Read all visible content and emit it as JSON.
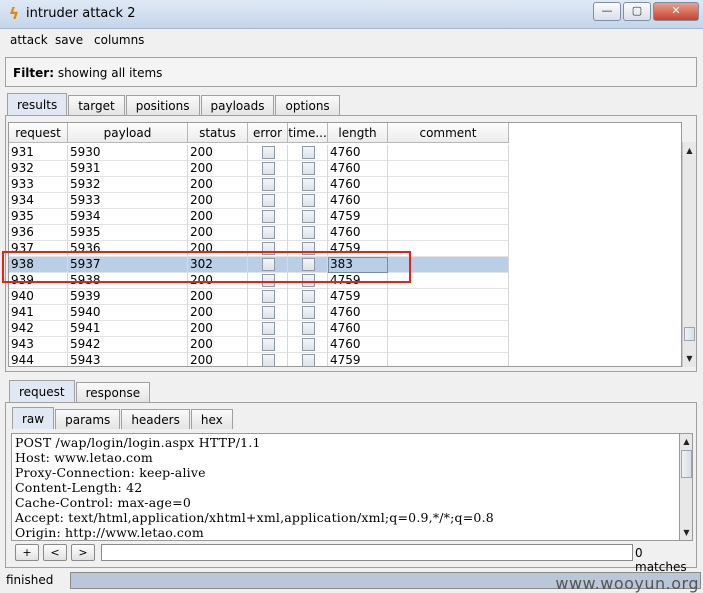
{
  "window": {
    "title": "intruder attack 2",
    "minimize": "—",
    "maximize": "▢",
    "close": "✕",
    "icon": "burp-lightning-icon"
  },
  "menu": [
    "attack",
    "save",
    "columns"
  ],
  "filter": {
    "label": "Filter:",
    "text": "showing all items"
  },
  "main_tabs": [
    {
      "label": "results",
      "active": true
    },
    {
      "label": "target",
      "active": false
    },
    {
      "label": "positions",
      "active": false
    },
    {
      "label": "payloads",
      "active": false
    },
    {
      "label": "options",
      "active": false
    }
  ],
  "table": {
    "columns": [
      "request",
      "payload",
      "status",
      "error",
      "time...",
      "length",
      "comment"
    ],
    "rows": [
      {
        "request": "931",
        "payload": "5930",
        "status": "200",
        "length": "4760"
      },
      {
        "request": "932",
        "payload": "5931",
        "status": "200",
        "length": "4760"
      },
      {
        "request": "933",
        "payload": "5932",
        "status": "200",
        "length": "4760"
      },
      {
        "request": "934",
        "payload": "5933",
        "status": "200",
        "length": "4760"
      },
      {
        "request": "935",
        "payload": "5934",
        "status": "200",
        "length": "4759"
      },
      {
        "request": "936",
        "payload": "5935",
        "status": "200",
        "length": "4760"
      },
      {
        "request": "937",
        "payload": "5936",
        "status": "200",
        "length": "4759"
      },
      {
        "request": "938",
        "payload": "5937",
        "status": "302",
        "length": "383",
        "selected": true
      },
      {
        "request": "939",
        "payload": "5938",
        "status": "200",
        "length": "4759"
      },
      {
        "request": "940",
        "payload": "5939",
        "status": "200",
        "length": "4759"
      },
      {
        "request": "941",
        "payload": "5940",
        "status": "200",
        "length": "4760"
      },
      {
        "request": "942",
        "payload": "5941",
        "status": "200",
        "length": "4760"
      },
      {
        "request": "943",
        "payload": "5942",
        "status": "200",
        "length": "4760"
      },
      {
        "request": "944",
        "payload": "5943",
        "status": "200",
        "length": "4759"
      }
    ]
  },
  "detail_tabs": [
    {
      "label": "request",
      "active": true
    },
    {
      "label": "response",
      "active": false
    }
  ],
  "view_tabs": [
    {
      "label": "raw",
      "active": true
    },
    {
      "label": "params",
      "active": false
    },
    {
      "label": "headers",
      "active": false
    },
    {
      "label": "hex",
      "active": false
    }
  ],
  "request_lines": [
    "POST /wap/login/login.aspx HTTP/1.1",
    "Host: www.letao.com",
    "Proxy-Connection: keep-alive",
    "Content-Length: 42",
    "Cache-Control: max-age=0",
    "Accept: text/html,application/xhtml+xml,application/xml;q=0.9,*/*;q=0.8",
    "Origin: http://www.letao.com"
  ],
  "search": {
    "plus": "+",
    "prev": "<",
    "next": ">",
    "value": "",
    "matches": "0 matches"
  },
  "status": {
    "text": "finished",
    "progress": 1.0
  },
  "watermark": "www.wooyun.org",
  "colors": {
    "selected_row": "#b8cfe5",
    "highlight_box": "#e2231a"
  }
}
